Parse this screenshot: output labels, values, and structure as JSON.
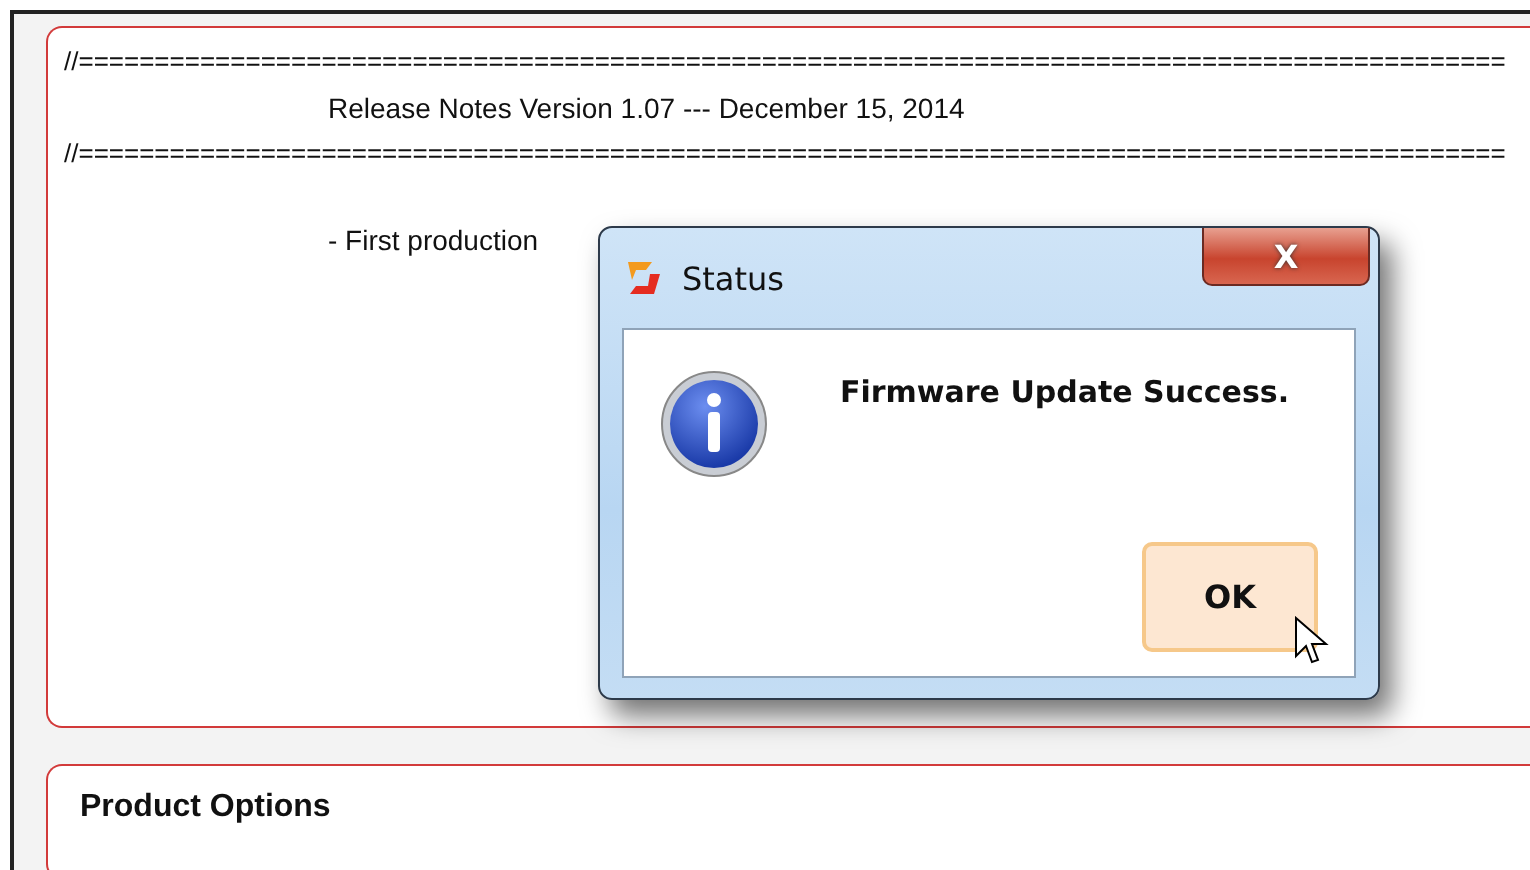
{
  "release_notes": {
    "top_rule": "//==============================================================================================",
    "heading": "Release Notes Version 1.07 --- December 15, 2014",
    "bottom_rule": "//==============================================================================================",
    "item": "- First production"
  },
  "dialog": {
    "title": "Status",
    "message": "Firmware Update Success.",
    "close_label": "X",
    "buttons": [
      {
        "label": "OK",
        "focused": true
      }
    ]
  },
  "product_options": {
    "title": "Product Options"
  }
}
